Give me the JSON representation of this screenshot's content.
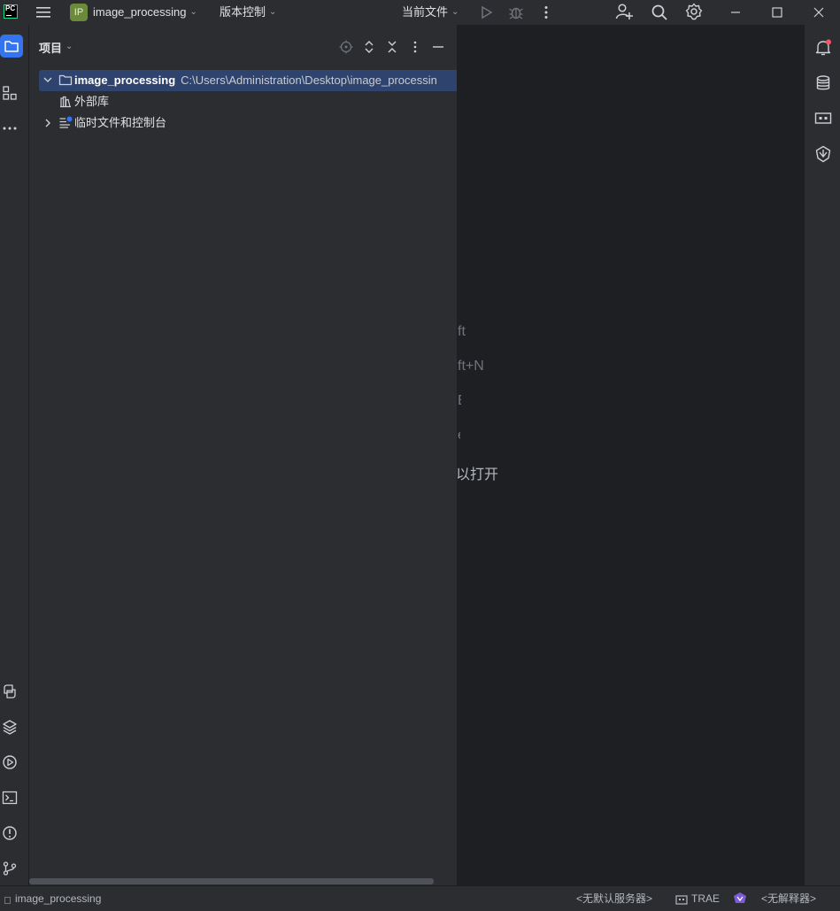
{
  "titlebar": {
    "app_logo": "PC",
    "project_badge": "IP",
    "project_name": "image_processing",
    "vcs_menu": "版本控制",
    "run_config": "当前文件",
    "colors": {
      "badge_bg": "#6c8a3b",
      "accent": "#3574f0"
    }
  },
  "project_panel": {
    "title": "项目",
    "tree": {
      "root_name": "image_processing",
      "root_path": "C:\\Users\\Administration\\Desktop\\image_processin",
      "external_libs": "外部库",
      "scratches": "临时文件和控制台"
    }
  },
  "editor": {
    "hints": [
      "ft",
      "ft+N",
      "E",
      "e",
      "以打开"
    ]
  },
  "statusbar": {
    "project": "image_processing",
    "server": "<无默认服务器>",
    "trae": "TRAE",
    "interpreter": "<无解释器>"
  },
  "icons": {
    "left_top": [
      "folder-icon",
      "structure-icon",
      "more-icon"
    ],
    "left_bottom": [
      "python-console-icon",
      "layers-icon",
      "services-icon",
      "terminal-icon",
      "problems-icon",
      "git-icon"
    ],
    "right": [
      "notifications-icon",
      "database-icon",
      "ai-assistant-icon",
      "trae-icon"
    ]
  }
}
